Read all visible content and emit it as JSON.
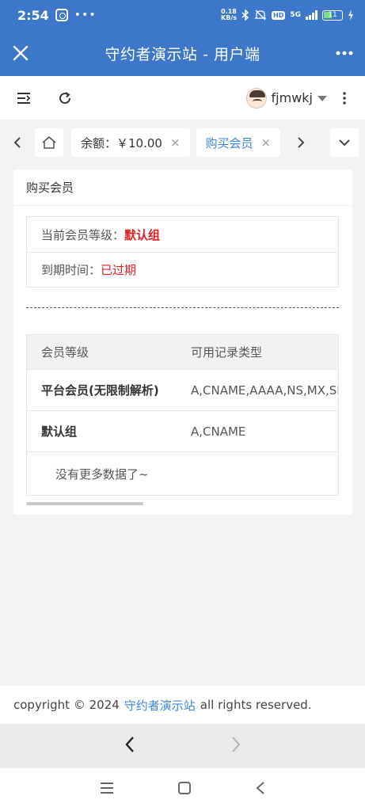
{
  "status": {
    "time": "2:54",
    "dots": "•••",
    "net_speed_top": "0.18",
    "net_speed_unit": "KB/s",
    "hd": "HD",
    "signal": "5G",
    "battery": "11"
  },
  "titlebar": {
    "title": "守约者演示站 - 用户端",
    "close_icon": "close-icon",
    "more_icon": "more-icon"
  },
  "appbar": {
    "username": "fjmwkj"
  },
  "tabs": {
    "balance_label": "余额：￥10.00",
    "active_label": "购买会员",
    "close_symbol": "×"
  },
  "card": {
    "title": "购买会员",
    "current_level_label": "当前会员等级：",
    "current_level_value": "默认组",
    "expire_label": "到期时间：",
    "expire_value": "已过期"
  },
  "table": {
    "columns": [
      "会员等级",
      "可用记录类型"
    ],
    "rows": [
      {
        "level": "平台会员(无限制解析)",
        "types": "A,CNAME,AAAA,NS,MX,SRV,TXT"
      },
      {
        "level": "默认组",
        "types": "A,CNAME"
      }
    ],
    "empty_text": "没有更多数据了~"
  },
  "footer": {
    "prefix": "copyright © 2024",
    "link": "守约者演示站",
    "suffix": "all rights reserved."
  },
  "colors": {
    "brand_blue": "#3c77c9",
    "link_blue": "#3c86d8",
    "alert_red": "#e02020"
  }
}
